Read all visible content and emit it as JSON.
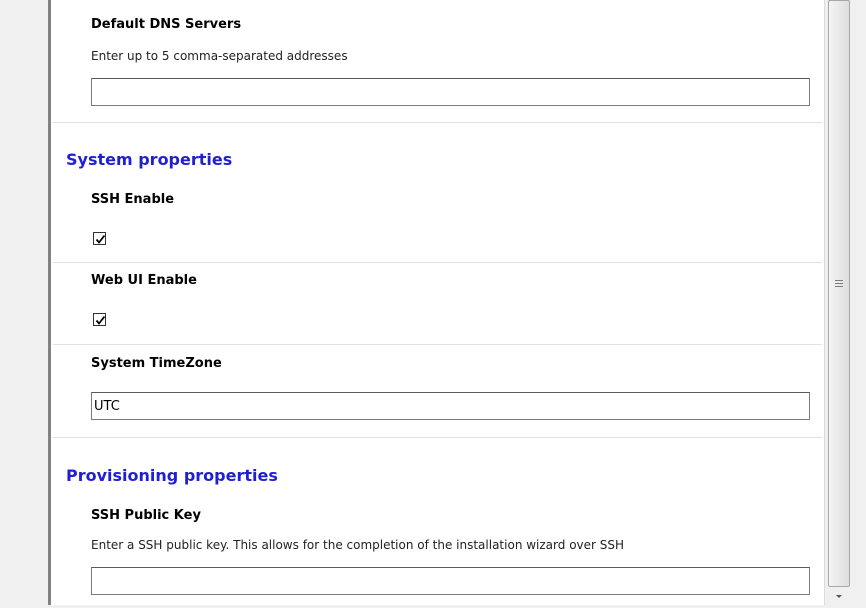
{
  "network": {
    "dns_label": "Default DNS Servers",
    "dns_description": "Enter up to 5 comma-separated addresses",
    "dns_value": ""
  },
  "system": {
    "heading": "System properties",
    "ssh_enable_label": "SSH Enable",
    "ssh_enable_checked": true,
    "web_ui_enable_label": "Web UI Enable",
    "web_ui_enable_checked": true,
    "timezone_label": "System TimeZone",
    "timezone_value": "UTC"
  },
  "provisioning": {
    "heading": "Provisioning properties",
    "ssh_key_label": "SSH Public Key",
    "ssh_key_description": "Enter a SSH public key. This allows for the completion of the installation wizard over SSH",
    "ssh_key_value": ""
  },
  "colors": {
    "heading": "#1f1fd6",
    "panel_background": "#ffffff",
    "window_background": "#f0f0f0"
  },
  "icons": {
    "checkbox_mark": "checkmark-icon",
    "scroll_grip": "scrollbar-grip-icon",
    "scroll_down": "arrow-down-icon"
  }
}
